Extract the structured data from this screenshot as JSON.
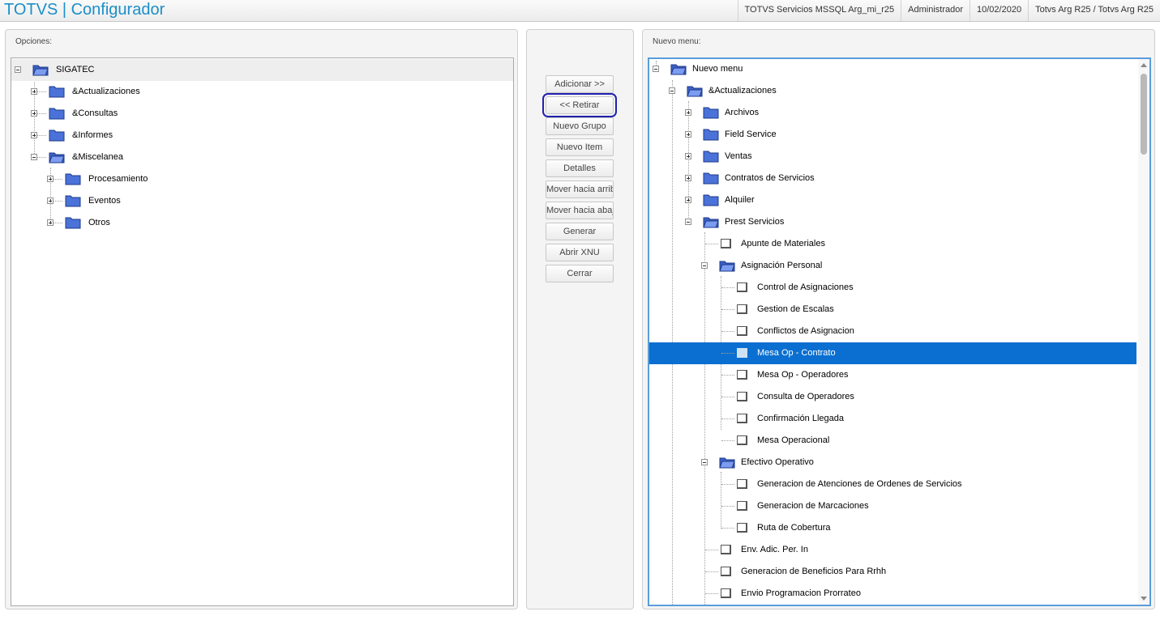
{
  "header": {
    "title": "TOTVS | Configurador",
    "server": "TOTVS Servicios MSSQL Arg_mi_r25",
    "user": "Administrador",
    "date": "10/02/2020",
    "environment": "Totvs Arg R25 / Totvs Arg R25"
  },
  "left_panel": {
    "title": "Opciones:",
    "nodes": [
      {
        "label": "SIGATEC"
      },
      {
        "label": "&Actualizaciones"
      },
      {
        "label": "&Consultas"
      },
      {
        "label": "&Informes"
      },
      {
        "label": "&Miscelanea"
      },
      {
        "label": "Procesamiento"
      },
      {
        "label": "Eventos"
      },
      {
        "label": "Otros"
      }
    ]
  },
  "buttons": {
    "add": "Adicionar >>",
    "remove": "<< Retirar",
    "new_group": "Nuevo Grupo",
    "new_item": "Nuevo Item",
    "details": "Detalles",
    "move_up": "Mover hacia arriba",
    "move_down": "Mover hacia abajo",
    "generate": "Generar",
    "open_xnu": "Abrir XNU",
    "close": "Cerrar"
  },
  "right_panel": {
    "title": "Nuevo menu:",
    "nodes": [
      {
        "label": "Nuevo menu"
      },
      {
        "label": "&Actualizaciones"
      },
      {
        "label": "Archivos"
      },
      {
        "label": "Field Service"
      },
      {
        "label": "Ventas"
      },
      {
        "label": "Contratos de Servicios"
      },
      {
        "label": "Alquiler"
      },
      {
        "label": "Prest Servicios"
      },
      {
        "label": "Apunte de Materiales"
      },
      {
        "label": "Asignación Personal"
      },
      {
        "label": "Control de Asignaciones"
      },
      {
        "label": "Gestion de Escalas"
      },
      {
        "label": "Conflictos de Asignacion"
      },
      {
        "label": "Mesa Op - Contrato"
      },
      {
        "label": "Mesa Op - Operadores"
      },
      {
        "label": "Consulta de Operadores"
      },
      {
        "label": "Confirmación Llegada"
      },
      {
        "label": "Mesa Operacional"
      },
      {
        "label": "Efectivo Operativo"
      },
      {
        "label": "Generacion de Atenciones de Ordenes de Servicios"
      },
      {
        "label": "Generacion de Marcaciones"
      },
      {
        "label": "Ruta de Cobertura"
      },
      {
        "label": "Env. Adic. Per. In"
      },
      {
        "label": "Generacion de Beneficios Para Rrhh"
      },
      {
        "label": "Envio Programacion Prorrateo"
      }
    ]
  },
  "colors": {
    "accent": "#1b8fc8",
    "selection": "#0a6fd0",
    "folder": "#4a72d8"
  }
}
